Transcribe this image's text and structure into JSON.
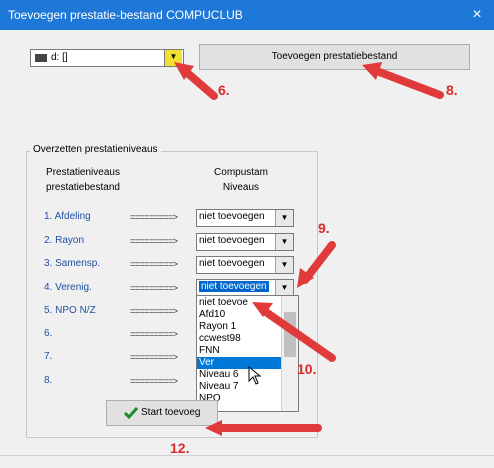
{
  "window": {
    "title": "Toevoegen prestatie-bestand COMPUCLUB",
    "close": "×"
  },
  "drive": {
    "value": "d: []"
  },
  "add_button": {
    "label": "Toevoegen prestatiebestand"
  },
  "group": {
    "title": "Overzetten prestatieniveaus",
    "col1_header": [
      "Prestatieniveaus",
      "prestatiebestand"
    ],
    "col2_header": [
      "Compustam",
      "Niveaus"
    ]
  },
  "rows": [
    {
      "label": "1. Afdeling",
      "arrow": "=========>",
      "value": "niet toevoegen"
    },
    {
      "label": "2. Rayon",
      "arrow": "=========>",
      "value": "niet toevoegen"
    },
    {
      "label": "3. Samensp.",
      "arrow": "=========>",
      "value": "niet toevoegen"
    },
    {
      "label": "4. Verenig.",
      "arrow": "=========>",
      "value": "niet toevoegen"
    },
    {
      "label": "5. NPO N/Z",
      "arrow": "=========>",
      "value": ""
    },
    {
      "label": "6.",
      "arrow": "=========>",
      "value": ""
    },
    {
      "label": "7.",
      "arrow": "=========>",
      "value": ""
    },
    {
      "label": "8.",
      "arrow": "=========>",
      "value": ""
    }
  ],
  "dropdown_list": [
    "niet toevoe",
    "Afd10",
    "Rayon 1",
    "ccwest98",
    "FNN",
    "Ver",
    "Niveau 6",
    "Niveau 7",
    "NPO"
  ],
  "dropdown_selected": "Ver",
  "start_button": {
    "label": "Start toevoeg"
  },
  "annotations": [
    "6.",
    "8.",
    "9.",
    "10.",
    "12."
  ],
  "colors": {
    "titlebar": "#1e78d7",
    "accent": "#0078d7",
    "annotation": "#d92b2b"
  }
}
